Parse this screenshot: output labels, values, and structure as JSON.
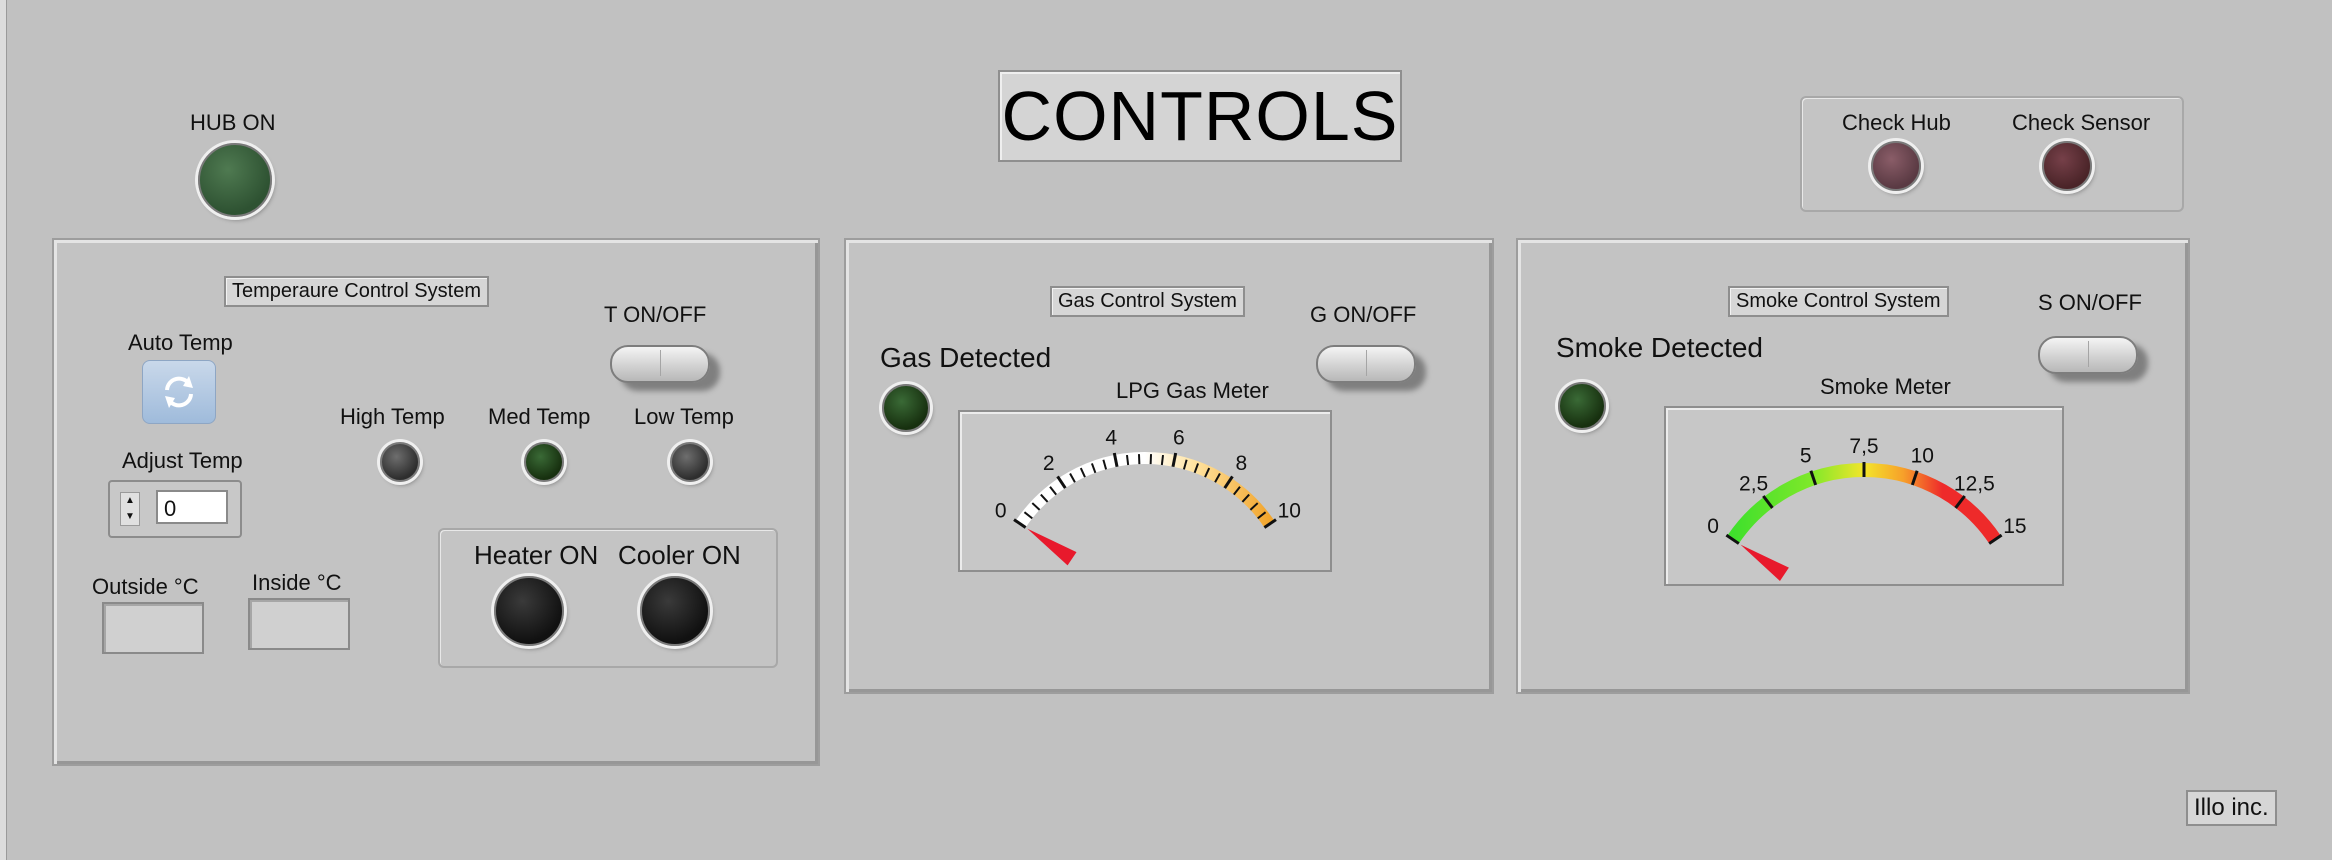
{
  "title": "CONTROLS",
  "hub": {
    "label": "HUB ON"
  },
  "checks": {
    "hub_label": "Check Hub",
    "sensor_label": "Check Sensor"
  },
  "temperature": {
    "title": "Temperaure Control System",
    "toggle_label": "T ON/OFF",
    "auto_label": "Auto Temp",
    "adjust_label": "Adjust Temp",
    "adjust_value": "0",
    "high_label": "High Temp",
    "med_label": "Med Temp",
    "low_label": "Low Temp",
    "outside_label": "Outside °C",
    "inside_label": "Inside °C",
    "heater_label": "Heater ON",
    "cooler_label": "Cooler ON"
  },
  "gas": {
    "title": "Gas Control System",
    "toggle_label": "G ON/OFF",
    "detected_label": "Gas Detected",
    "meter_label": "LPG Gas Meter",
    "meter_value": 0,
    "meter_min": 0,
    "meter_max": 10,
    "tick_labels": [
      "0",
      "2",
      "4",
      "6",
      "8",
      "10"
    ]
  },
  "smoke": {
    "title": "Smoke Control System",
    "toggle_label": "S ON/OFF",
    "detected_label": "Smoke Detected",
    "meter_label": "Smoke Meter",
    "meter_value": 0,
    "meter_min": 0,
    "meter_max": 15,
    "tick_labels": [
      "0",
      "2,5",
      "5",
      "7,5",
      "10",
      "12,5",
      "15"
    ]
  },
  "credit": "Illo inc.",
  "colors": {
    "hub_led": "#3d6540",
    "indicator_green": "#2a4f24",
    "needle": "#e8192c",
    "gas_scale_warm": "#f2a52c",
    "smoke_green": "#3fe02c",
    "smoke_yellow": "#f3e52b",
    "smoke_red": "#ee2a2a"
  }
}
